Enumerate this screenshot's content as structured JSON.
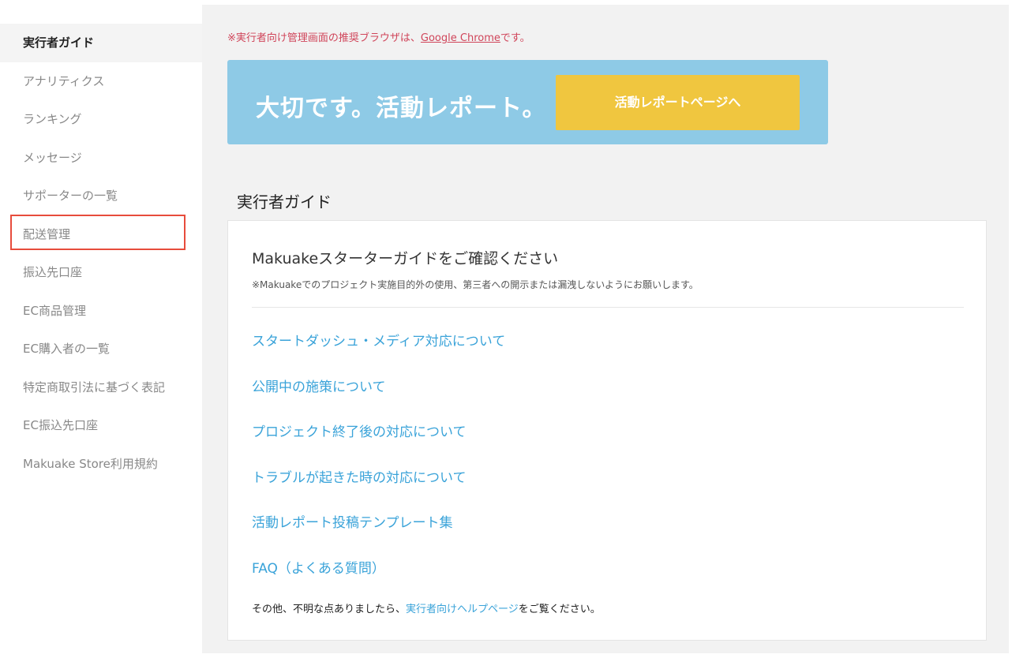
{
  "sidebar": {
    "items": [
      {
        "label": "実行者ガイド",
        "active": true
      },
      {
        "label": "アナリティクス"
      },
      {
        "label": "ランキング"
      },
      {
        "label": "メッセージ"
      },
      {
        "label": "サポーターの一覧"
      },
      {
        "label": "配送管理",
        "highlighted": true
      },
      {
        "label": "振込先口座"
      },
      {
        "label": "EC商品管理"
      },
      {
        "label": "EC購入者の一覧"
      },
      {
        "label": "特定商取引法に基づく表記"
      },
      {
        "label": "EC振込先口座"
      },
      {
        "label": "Makuake Store利用規約"
      }
    ]
  },
  "notice": {
    "prefix": "※実行者向け管理画面の推奨ブラウザは、",
    "link": "Google Chrome",
    "suffix": "です。"
  },
  "banner": {
    "title": "大切です。活動レポート。",
    "button_label": "活動レポートページへ"
  },
  "guide": {
    "section_title": "実行者ガイド",
    "card_title": "Makuakeスターターガイドをご確認ください",
    "card_note": "※Makuakeでのプロジェクト実施目的外の使用、第三者への開示または漏洩しないようにお願いします。",
    "links": [
      "スタートダッシュ・メディア対応について",
      "公開中の施策について",
      "プロジェクト終了後の対応について",
      "トラブルが起きた時の対応について",
      "活動レポート投稿テンプレート集",
      "FAQ（よくある質問）"
    ],
    "footer": {
      "prefix": "その他、不明な点ありましたら、",
      "link": "実行者向けヘルプページ",
      "suffix": "をご覧ください。"
    }
  },
  "colors": {
    "banner_bg": "#8ecae6",
    "banner_button": "#f0c63f",
    "link": "#3aa3d9",
    "notice": "#d0455a",
    "highlight_border": "#e74c3c"
  }
}
